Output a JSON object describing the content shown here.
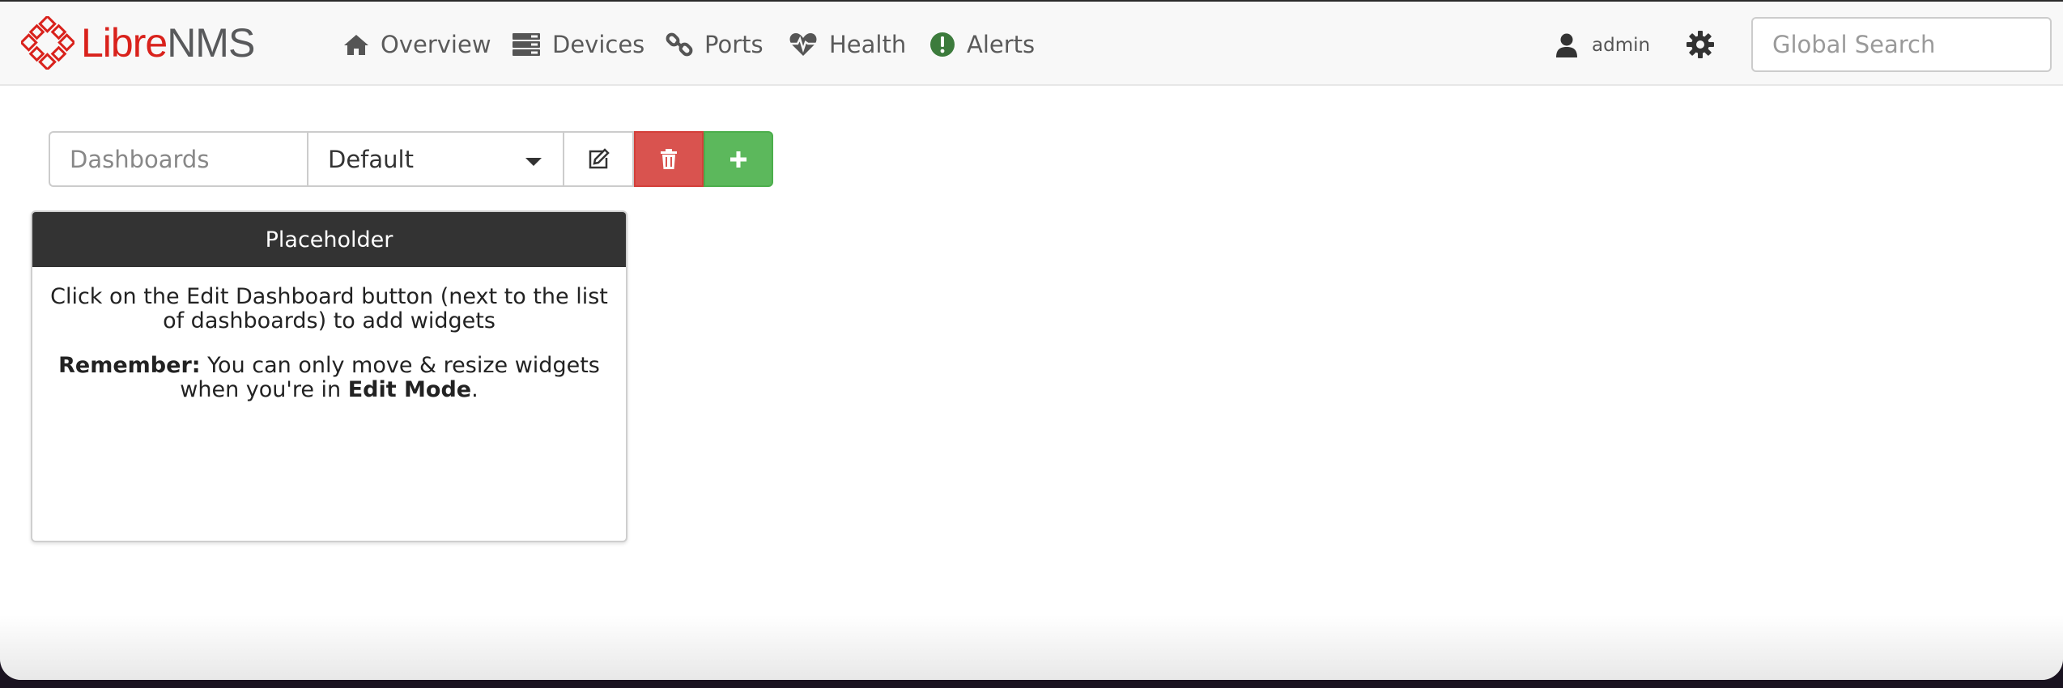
{
  "brand": {
    "libre": "Libre",
    "nms": "NMS",
    "accent": "#d9221c"
  },
  "nav": [
    {
      "label": "Overview",
      "icon": "home-icon"
    },
    {
      "label": "Devices",
      "icon": "server-icon"
    },
    {
      "label": "Ports",
      "icon": "link-icon"
    },
    {
      "label": "Health",
      "icon": "heartbeat-icon"
    },
    {
      "label": "Alerts",
      "icon": "exclamation-circle-icon"
    }
  ],
  "user": {
    "name": "admin",
    "icon": "user-icon"
  },
  "settings_icon": "gear-icon",
  "search": {
    "placeholder": "Global Search",
    "value": ""
  },
  "dashboard_bar": {
    "label": "Dashboards",
    "selected": "Default",
    "edit_icon": "edit-icon",
    "delete_icon": "trash-icon",
    "add_icon": "plus-icon",
    "colors": {
      "delete": "#d9534f",
      "add": "#5cb85c"
    }
  },
  "widget": {
    "title": "Placeholder",
    "line1": "Click on the Edit Dashboard button (next to the list of dashboards) to add widgets",
    "remember_label": "Remember:",
    "remember_text": " You can only move & resize widgets when you're in ",
    "edit_mode": "Edit Mode",
    "period": "."
  }
}
